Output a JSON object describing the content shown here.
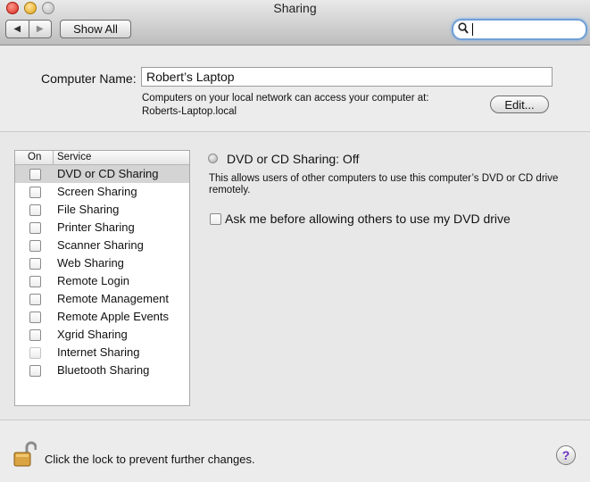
{
  "window": {
    "title": "Sharing",
    "back_symbol": "◀",
    "forward_symbol": "▶",
    "show_all_label": "Show All",
    "search_value": ""
  },
  "computer_name": {
    "label": "Computer Name:",
    "value": "Robert’s Laptop",
    "help_line1": "Computers on your local network can access your computer at:",
    "help_line2": "Roberts-Laptop.local",
    "edit_label": "Edit..."
  },
  "services": {
    "header_on": "On",
    "header_service": "Service",
    "items": [
      {
        "label": "DVD or CD Sharing",
        "checked": false,
        "selected": true
      },
      {
        "label": "Screen Sharing",
        "checked": false
      },
      {
        "label": "File Sharing",
        "checked": false
      },
      {
        "label": "Printer Sharing",
        "checked": false
      },
      {
        "label": "Scanner Sharing",
        "checked": false
      },
      {
        "label": "Web Sharing",
        "checked": false
      },
      {
        "label": "Remote Login",
        "checked": false
      },
      {
        "label": "Remote Management",
        "checked": false
      },
      {
        "label": "Remote Apple Events",
        "checked": false
      },
      {
        "label": "Xgrid Sharing",
        "checked": false
      },
      {
        "label": "Internet Sharing",
        "checked": false,
        "disabled": true
      },
      {
        "label": "Bluetooth Sharing",
        "checked": false
      }
    ]
  },
  "detail": {
    "status_title": "DVD or CD Sharing: Off",
    "description": "This allows users of other computers to use this computer’s DVD or CD drive remotely.",
    "ask_label": "Ask me before allowing others to use my DVD drive",
    "ask_checked": false
  },
  "footer": {
    "lock_text": "Click the lock to prevent further changes.",
    "help_symbol": "?"
  },
  "colors": {
    "selected_row": "#d4d4d4",
    "search_focus_ring": "#6f9fd6",
    "help_glyph": "#6a2fbf"
  }
}
